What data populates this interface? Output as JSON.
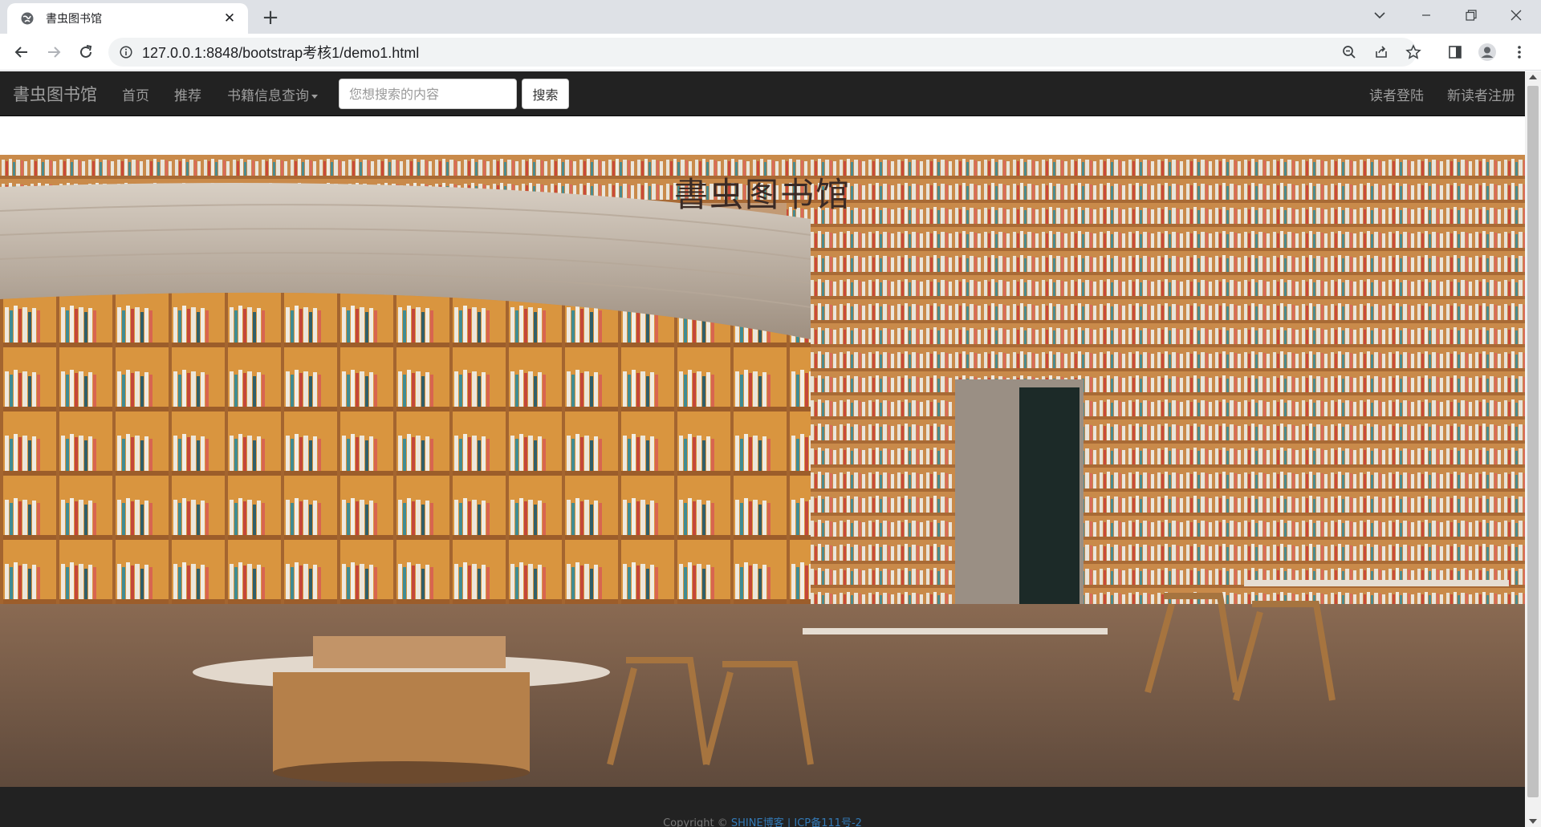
{
  "browser": {
    "tab_title": "書虫图书馆",
    "url": "127.0.0.1:8848/bootstrap考核1/demo1.html"
  },
  "navbar": {
    "brand": "書虫图书馆",
    "links": [
      "首页",
      "推荐",
      "书籍信息查询"
    ],
    "search_placeholder": "您想搜索的内容",
    "search_button": "搜索",
    "right_links": [
      "读者登陆",
      "新读者注册"
    ]
  },
  "hero": {
    "title": "書虫图书馆"
  },
  "footer": {
    "copyright_prefix": "Copyright ©",
    "blog_link": "SHINE博客",
    "separator": "|",
    "icp_link": "ICP备111号-2"
  },
  "colors": {
    "navbar_bg": "#222222",
    "nav_text": "#9d9d9d",
    "link": "#337ab7"
  }
}
